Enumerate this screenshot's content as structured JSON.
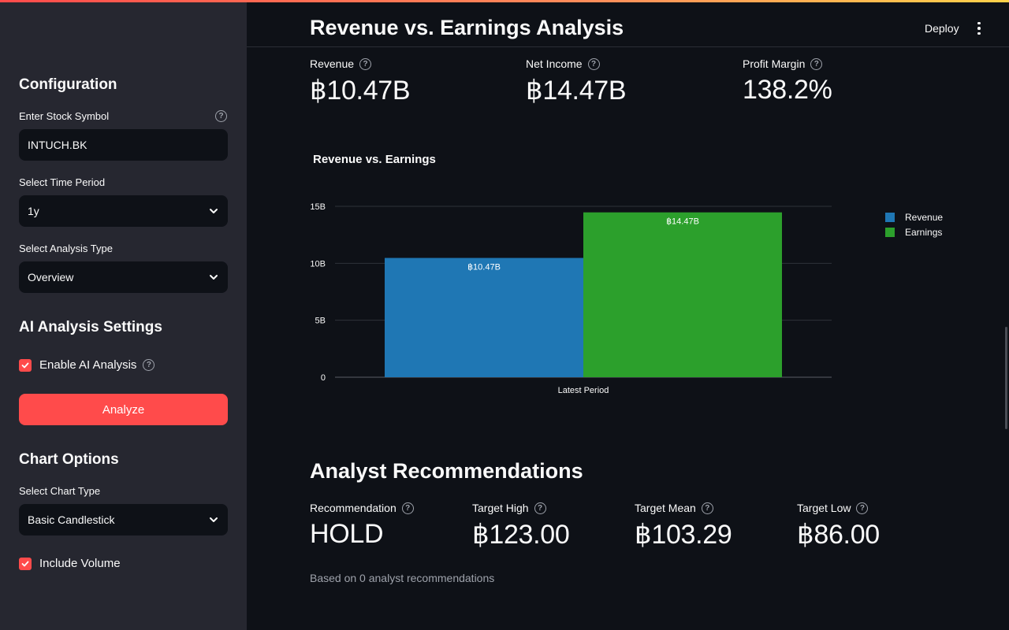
{
  "colors": {
    "accent": "#ff4b4b",
    "sidebar_bg": "#262730",
    "main_bg": "#0e1117",
    "revenue": "#1f77b4",
    "earnings": "#2ca02c"
  },
  "sidebar": {
    "config_heading": "Configuration",
    "symbol": {
      "label": "Enter Stock Symbol",
      "value": "INTUCH.BK"
    },
    "time_period": {
      "label": "Select Time Period",
      "value": "1y"
    },
    "analysis_type": {
      "label": "Select Analysis Type",
      "value": "Overview"
    },
    "ai_heading": "AI Analysis Settings",
    "enable_ai": {
      "label": "Enable AI Analysis",
      "checked": true
    },
    "analyze_button": "Analyze",
    "chart_options_heading": "Chart Options",
    "chart_type": {
      "label": "Select Chart Type",
      "value": "Basic Candlestick"
    },
    "include_volume": {
      "label": "Include Volume",
      "checked": true
    }
  },
  "header": {
    "title": "Revenue vs. Earnings Analysis",
    "deploy": "Deploy"
  },
  "metrics": [
    {
      "label": "Revenue",
      "value": "฿10.47B"
    },
    {
      "label": "Net Income",
      "value": "฿14.47B"
    },
    {
      "label": "Profit Margin",
      "value": "138.2%"
    }
  ],
  "chart_data": {
    "type": "bar",
    "title": "Revenue vs. Earnings",
    "categories": [
      "Latest Period"
    ],
    "series": [
      {
        "name": "Revenue",
        "values": [
          10.47
        ],
        "label": "฿10.47B",
        "color": "#1f77b4"
      },
      {
        "name": "Earnings",
        "values": [
          14.47
        ],
        "label": "฿14.47B",
        "color": "#2ca02c"
      }
    ],
    "y_ticks": [
      0,
      5,
      10,
      15
    ],
    "y_tick_labels": [
      "0",
      "5B",
      "10B",
      "15B"
    ],
    "ylim": [
      0,
      15
    ],
    "xlabel": "",
    "ylabel": "",
    "grid": true,
    "legend": "top-right"
  },
  "analyst": {
    "title": "Analyst Recommendations",
    "metrics": [
      {
        "label": "Recommendation",
        "value": "HOLD"
      },
      {
        "label": "Target High",
        "value": "฿123.00"
      },
      {
        "label": "Target Mean",
        "value": "฿103.29"
      },
      {
        "label": "Target Low",
        "value": "฿86.00"
      }
    ],
    "footnote": "Based on 0 analyst recommendations"
  }
}
